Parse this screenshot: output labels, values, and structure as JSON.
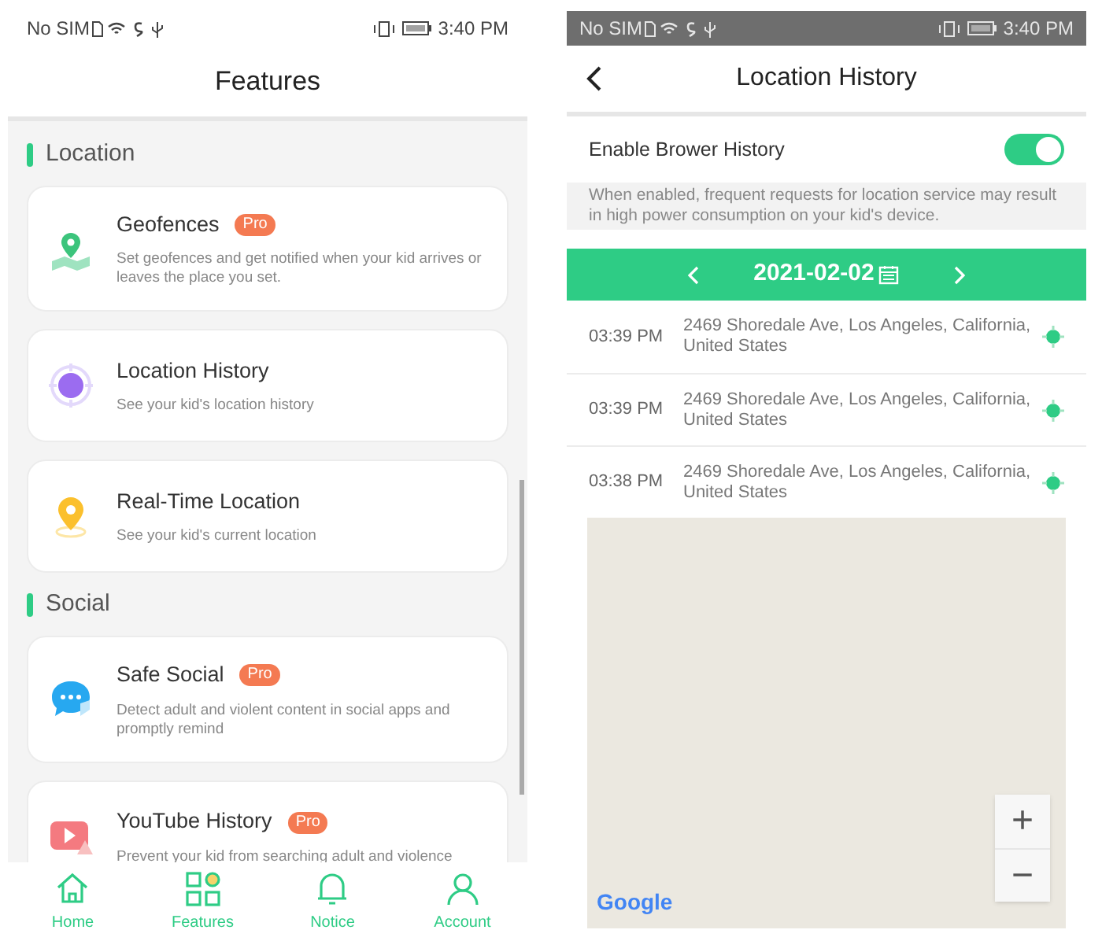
{
  "left_screen": {
    "status_bar": {
      "carrier": "No SIM",
      "time": "3:40 PM"
    },
    "title": "Features",
    "sections": [
      {
        "title": "Location",
        "items": [
          {
            "kind": "geofence",
            "title": "Geofences",
            "badge": "Pro",
            "description": "Set geofences and get notified when your kid arrives or leaves the place you set."
          },
          {
            "kind": "history",
            "title": "Location History",
            "description": "See your kid's location history"
          },
          {
            "kind": "realtime",
            "title": "Real-Time Location",
            "description": "See your kid's current location"
          }
        ]
      },
      {
        "title": "Social",
        "items": [
          {
            "kind": "social",
            "title": "Safe Social",
            "badge": "Pro",
            "description": "Detect adult and violent content in social apps and promptly remind"
          },
          {
            "kind": "youtube",
            "title": "YouTube History",
            "badge": "Pro",
            "description": "Prevent your kid from searching adult and violence"
          }
        ]
      }
    ],
    "nav": [
      {
        "kind": "home",
        "label": "Home"
      },
      {
        "kind": "features",
        "label": "Features"
      },
      {
        "kind": "notice",
        "label": "Notice"
      },
      {
        "kind": "account",
        "label": "Account"
      }
    ]
  },
  "right_screen": {
    "status_bar": {
      "carrier": "No SIM",
      "time": "3:40 PM"
    },
    "title": "Location History",
    "setting": {
      "label": "Enable Brower History",
      "on": true
    },
    "note": "When enabled, frequent requests for location service may result in high power consumption on your kid's device.",
    "date": "2021-02-02",
    "records": [
      {
        "time": "03:39 PM",
        "address": "2469 Shoredale Ave, Los Angeles, California, United States"
      },
      {
        "time": "03:39 PM",
        "address": "2469 Shoredale Ave, Los Angeles, California, United States"
      },
      {
        "time": "03:38 PM",
        "address": "2469 Shoredale Ave, Los Angeles, California, United States"
      }
    ],
    "map": {
      "attribution": "Google",
      "zoom_in": "+",
      "zoom_out": "−"
    }
  }
}
